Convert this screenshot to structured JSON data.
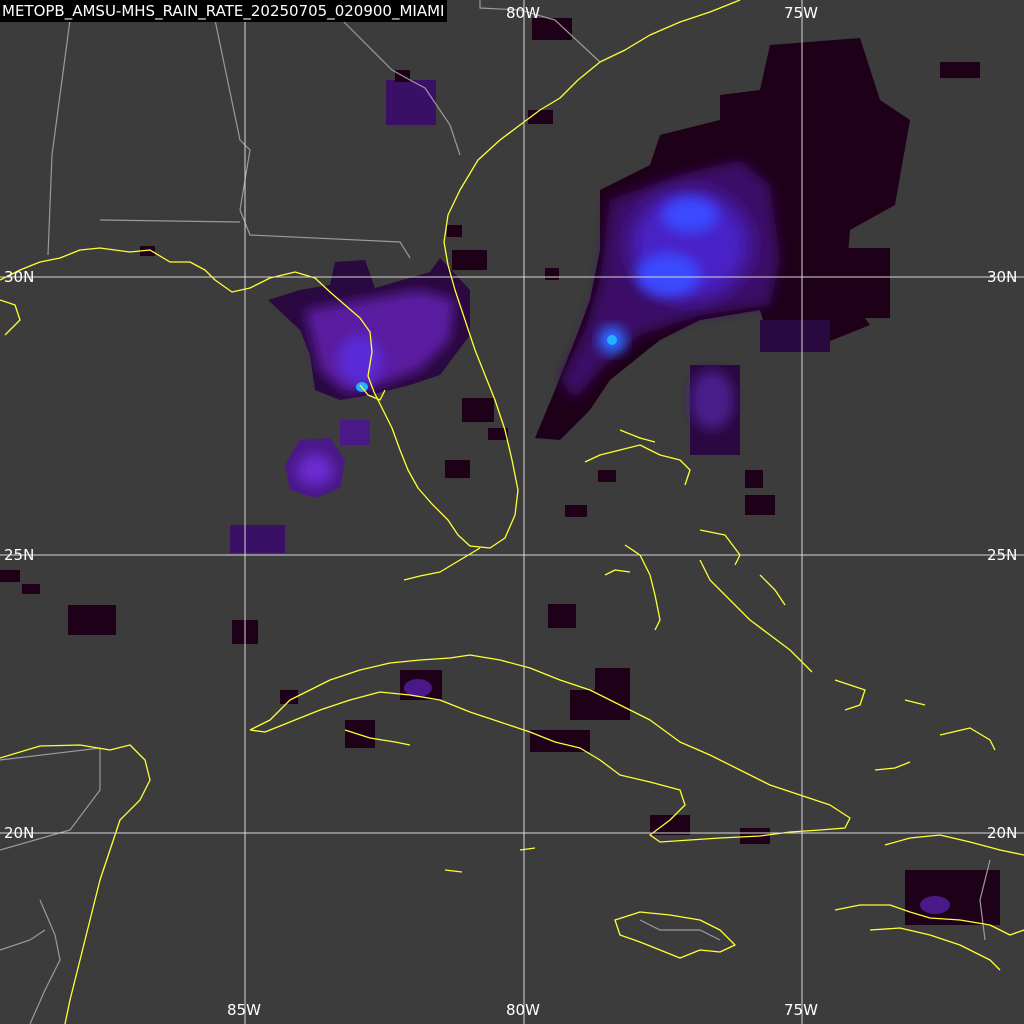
{
  "title": "METOPB_AMSU-MHS_RAIN_RATE_20250705_020900_MIAMI",
  "colors": {
    "background": "#3c3c3c",
    "coastline": "#ffff33",
    "borders": "#9a9a9a",
    "gridlines": "#d8d8d8",
    "rain_low": "#1a0014",
    "rain_mid": "#5a1599",
    "rain_high": "#3a3aff",
    "rain_peak": "#1fa6ff"
  },
  "grid_labels": {
    "top": [
      "80W",
      "75W"
    ],
    "bottom": [
      "85W",
      "80W",
      "75W"
    ],
    "left": [
      "30N",
      "25N",
      "20N"
    ],
    "right": [
      "30N",
      "25N",
      "20N"
    ]
  }
}
